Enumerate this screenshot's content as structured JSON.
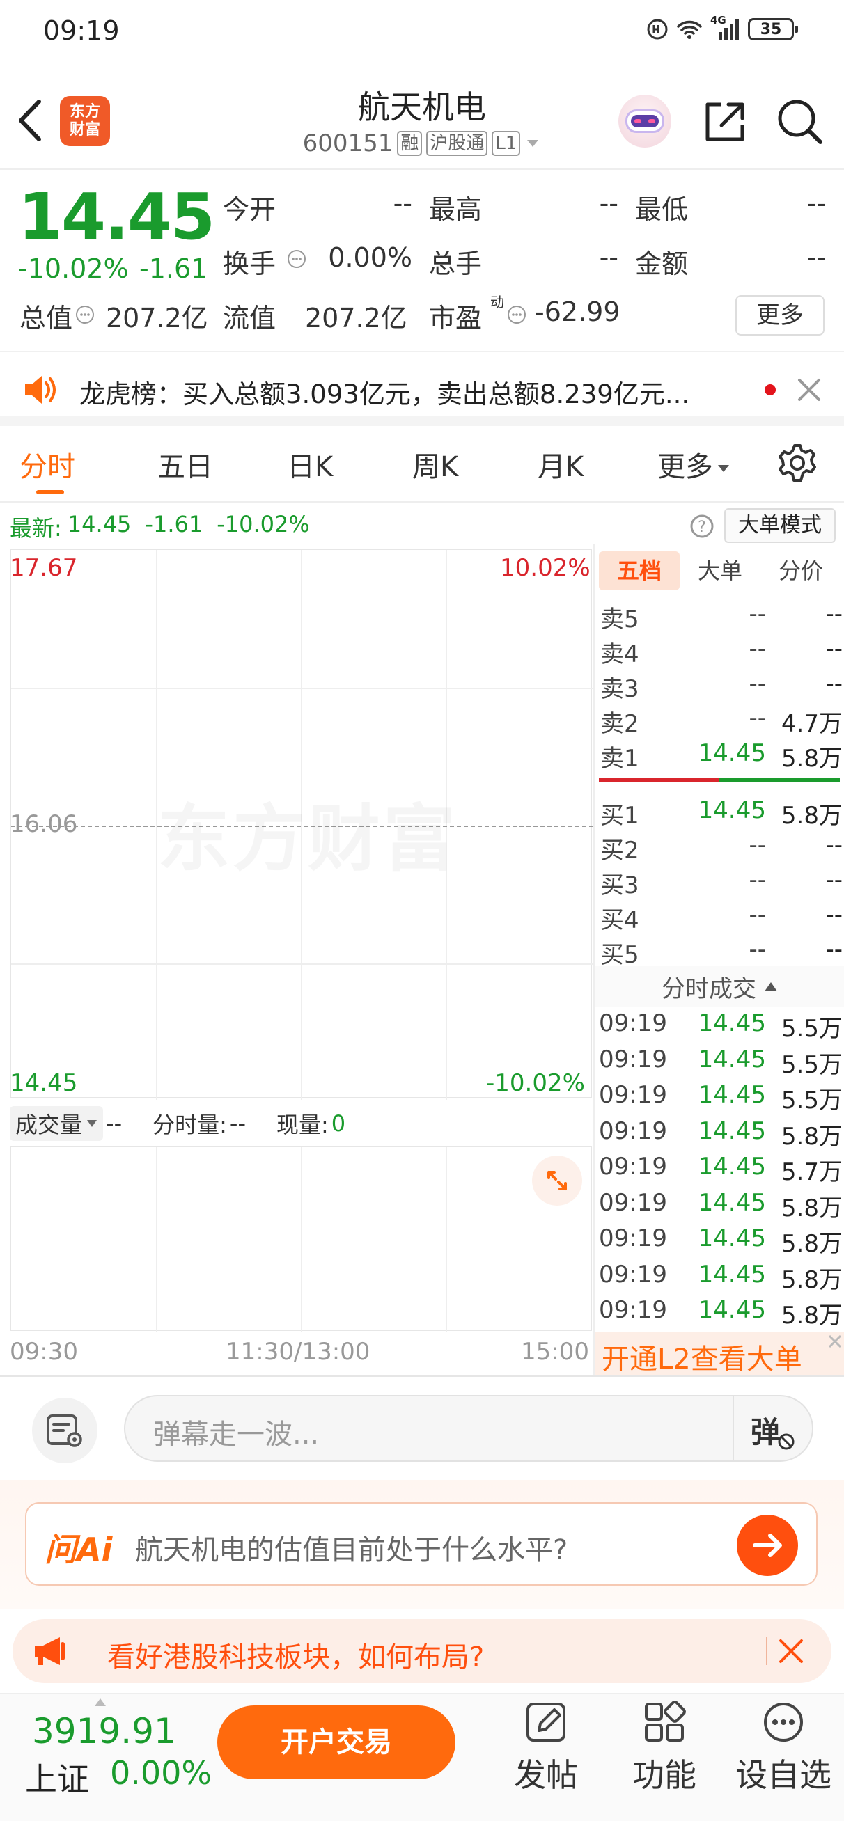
{
  "status": {
    "time": "09:19",
    "battery": "35",
    "signal_label": "4G"
  },
  "header": {
    "title": "航天机电",
    "code": "600151",
    "tag_margin": "融",
    "tag_connect": "沪股通",
    "tag_level": "L1",
    "logo_line1": "东方",
    "logo_line2": "财富"
  },
  "quote": {
    "price": "14.45",
    "change_pct": "-10.02%",
    "change": "-1.61",
    "fields": [
      {
        "label": "今开",
        "value": "--"
      },
      {
        "label": "最高",
        "value": "--"
      },
      {
        "label": "最低",
        "value": "--"
      },
      {
        "label": "换手",
        "value": "0.00%"
      },
      {
        "label": "总手",
        "value": "--"
      },
      {
        "label": "金额",
        "value": "--"
      },
      {
        "label": "总值",
        "value": "207.2亿"
      },
      {
        "label": "流值",
        "value": "207.2亿"
      },
      {
        "label": "市盈",
        "value": "-62.99",
        "sup": "动"
      }
    ],
    "more_button": "更多"
  },
  "notice": {
    "text": "龙虎榜：买入总额3.093亿元，卖出总额8.239亿元..."
  },
  "tabs": [
    {
      "label": "分时",
      "active": true
    },
    {
      "label": "五日"
    },
    {
      "label": "日K"
    },
    {
      "label": "周K"
    },
    {
      "label": "月K"
    },
    {
      "label": "更多"
    }
  ],
  "latest": {
    "label": "最新:",
    "price": "14.45",
    "change": "-1.61",
    "pct": "-10.02%",
    "mode_button": "大单模式"
  },
  "chart": {
    "y_top": "17.67",
    "y_mid": "16.06",
    "y_bottom": "14.45",
    "pct_top": "10.02%",
    "pct_bottom": "-10.02%",
    "watermark": "东方财富",
    "x_labels": [
      "09:30",
      "11:30/13:00",
      "15:00"
    ]
  },
  "volume": {
    "selector": "成交量",
    "value1": "--",
    "label2": "分时量:",
    "value2": "--",
    "label3": "现量:",
    "value3": "0"
  },
  "orderbook": {
    "tabs": [
      "五档",
      "大单",
      "分价"
    ],
    "asks": [
      {
        "label": "卖5",
        "price": "--",
        "vol": "--"
      },
      {
        "label": "卖4",
        "price": "--",
        "vol": "--"
      },
      {
        "label": "卖3",
        "price": "--",
        "vol": "--"
      },
      {
        "label": "卖2",
        "price": "--",
        "vol": "4.7万"
      },
      {
        "label": "卖1",
        "price": "14.45",
        "vol": "5.8万"
      }
    ],
    "bids": [
      {
        "label": "买1",
        "price": "14.45",
        "vol": "5.8万"
      },
      {
        "label": "买2",
        "price": "--",
        "vol": "--"
      },
      {
        "label": "买3",
        "price": "--",
        "vol": "--"
      },
      {
        "label": "买4",
        "price": "--",
        "vol": "--"
      },
      {
        "label": "买5",
        "price": "--",
        "vol": "--"
      }
    ]
  },
  "trades": {
    "title": "分时成交",
    "rows": [
      {
        "t": "09:19",
        "p": "14.45",
        "v": "5.5万"
      },
      {
        "t": "09:19",
        "p": "14.45",
        "v": "5.5万"
      },
      {
        "t": "09:19",
        "p": "14.45",
        "v": "5.5万"
      },
      {
        "t": "09:19",
        "p": "14.45",
        "v": "5.8万"
      },
      {
        "t": "09:19",
        "p": "14.45",
        "v": "5.7万"
      },
      {
        "t": "09:19",
        "p": "14.45",
        "v": "5.8万"
      },
      {
        "t": "09:19",
        "p": "14.45",
        "v": "5.8万"
      },
      {
        "t": "09:19",
        "p": "14.45",
        "v": "5.8万"
      },
      {
        "t": "09:19",
        "p": "14.45",
        "v": "5.8万"
      }
    ],
    "l2_banner": "开通L2查看大单"
  },
  "comment": {
    "placeholder": "弹幕走一波...",
    "danmu_label": "弹"
  },
  "ai": {
    "logo": "问Ai",
    "question": "航天机电的估值目前处于什么水平?"
  },
  "promo": {
    "text": "看好港股科技板块，如何布局?"
  },
  "bottom": {
    "index_value": "3919.91",
    "index_name": "上证",
    "index_pct": "0.00%",
    "trade_button": "开户交易",
    "nav": [
      "发帖",
      "功能",
      "设自选"
    ]
  }
}
